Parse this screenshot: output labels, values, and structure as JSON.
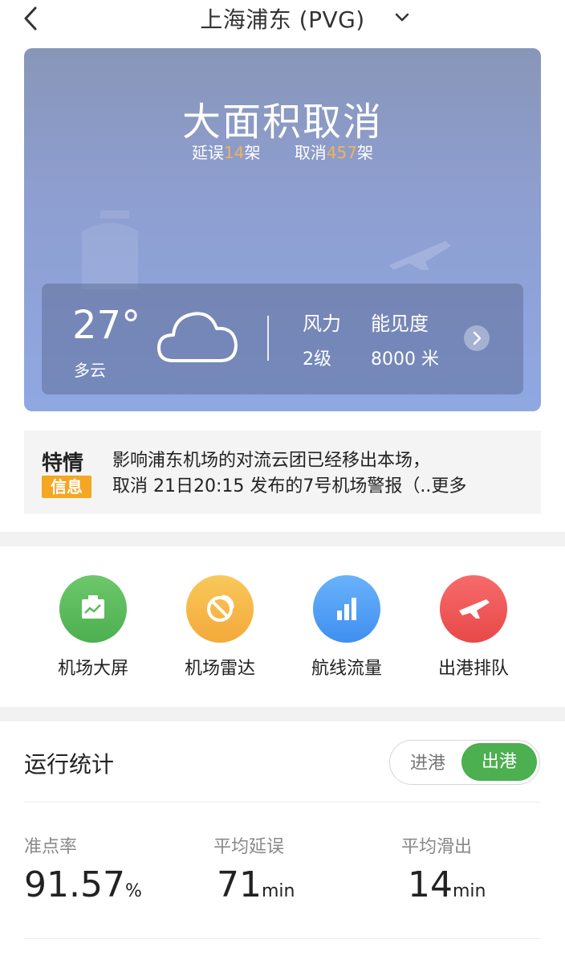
{
  "header": {
    "title": "上海浦东 (PVG)"
  },
  "status": {
    "title": "大面积取消",
    "delay_label": "延误",
    "delay_count": "14",
    "cancel_label": "取消",
    "cancel_count": "457",
    "unit": "架"
  },
  "weather": {
    "temp": "27°",
    "condition": "多云",
    "wind_label": "风力",
    "wind_value": "2级",
    "visibility_label": "能见度",
    "visibility_value": "8000 米"
  },
  "notice": {
    "badge_top": "特情",
    "badge_bottom": "信息",
    "line1": "影响浦东机场的对流云团已经移出本场，",
    "line2": "取消 21日20:15 发布的7号机场警报（..更多"
  },
  "actions": [
    {
      "label": "机场大屏",
      "color": "#5cb85c",
      "icon": "screen-icon"
    },
    {
      "label": "机场雷达",
      "color": "#f5b43c",
      "icon": "radar-icon"
    },
    {
      "label": "航线流量",
      "color": "#4a9cf5",
      "icon": "bar-chart-icon"
    },
    {
      "label": "出港排队",
      "color": "#f05a5a",
      "icon": "departure-plane-icon"
    }
  ],
  "stats": {
    "title": "运行统计",
    "toggle_in": "进港",
    "toggle_out": "出港",
    "items": [
      {
        "label": "准点率",
        "value": "91.57",
        "unit": "%"
      },
      {
        "label": "平均延误",
        "value": "71",
        "unit": "min"
      },
      {
        "label": "平均滑出",
        "value": "14",
        "unit": "min"
      }
    ]
  },
  "colors": {
    "accent_green": "#4caf50",
    "count_orange": "#f4b15c"
  }
}
